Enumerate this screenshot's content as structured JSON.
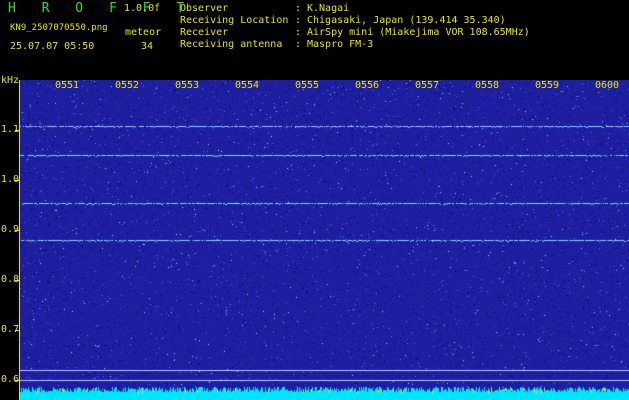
{
  "app": {
    "brand": "H R O F F T",
    "version": "1.0.0f",
    "filename": "KN9_2507070550.png",
    "meteor_label": "meteor",
    "datetime": "25.07.07 05:50",
    "meteor_count": "34"
  },
  "info": [
    {
      "label": "Observer",
      "value": "K.Nagai"
    },
    {
      "label": "Receiving Location",
      "value": "Chigasaki, Japan (139.414 35.340)"
    },
    {
      "label": "Receiver",
      "value": "AirSpy mini (Miakejima VOR 108.65MHz)"
    },
    {
      "label": "Receiving antenna",
      "value": "Maspro FM-3"
    }
  ],
  "y_axis": {
    "unit": "kHz",
    "ticks": [
      "1.1",
      "1.0",
      "0.9",
      "0.8",
      "0.7",
      "0.6"
    ]
  },
  "time_axis": {
    "ticks": [
      "0551",
      "0552",
      "0553",
      "0554",
      "0555",
      "0556",
      "0557",
      "0558",
      "0559",
      "0600"
    ]
  },
  "colors": {
    "background": "#000000",
    "text": "#e6e600",
    "brand": "#2fdc2f",
    "waterfall": "#1e1ea0",
    "signal": "#7fd4ff",
    "noise_floor": "#00e5ff"
  }
}
